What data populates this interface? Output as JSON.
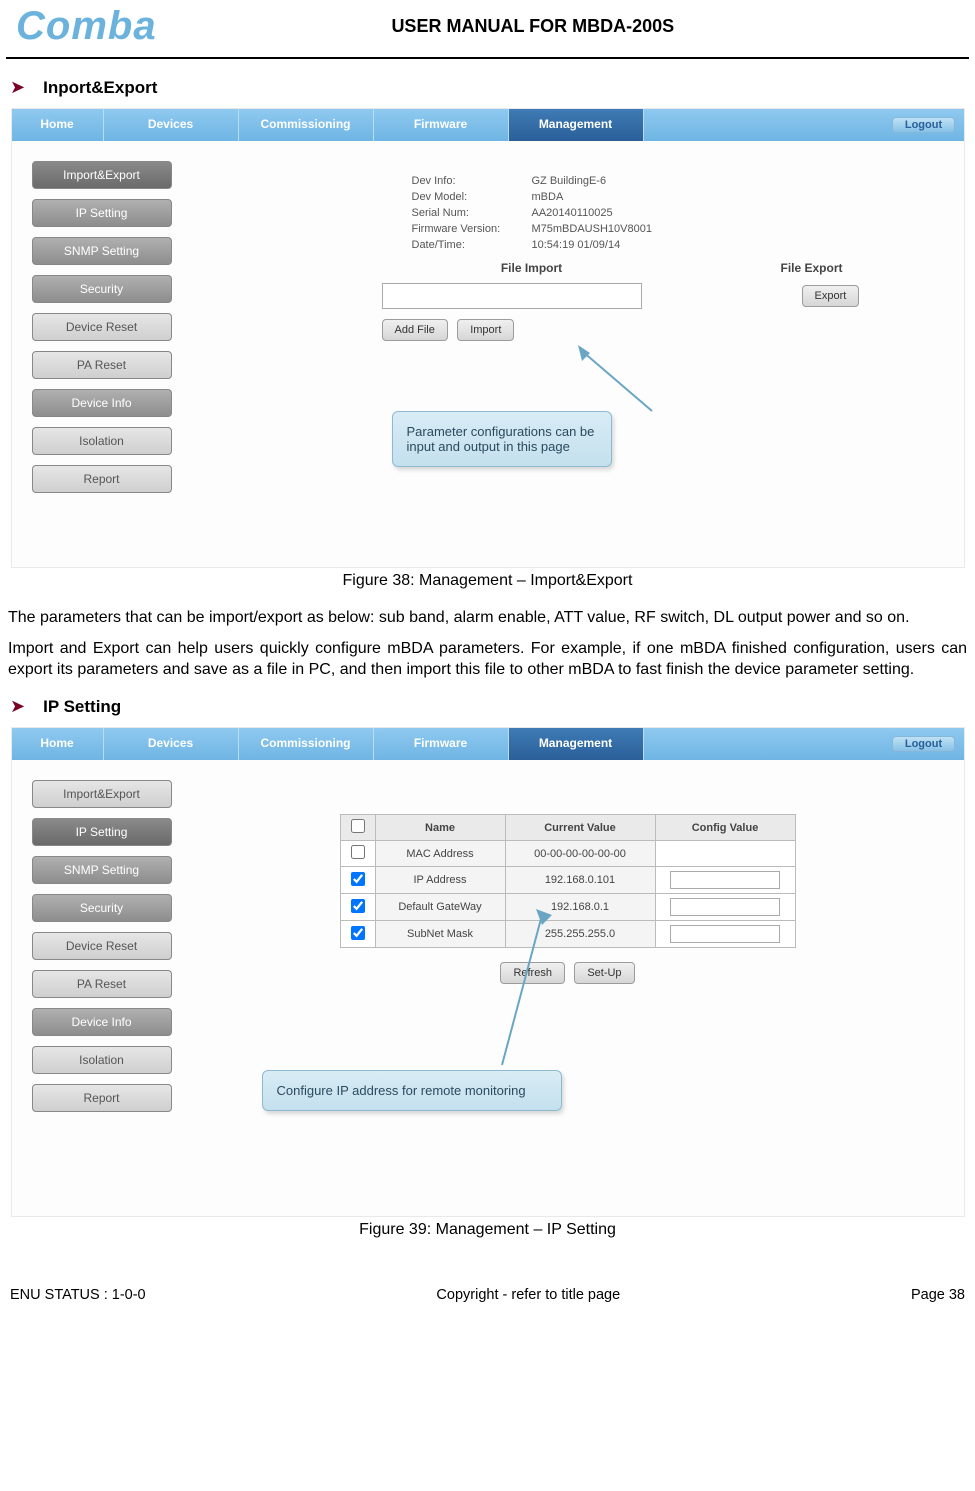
{
  "header": {
    "logo": "Comba",
    "doc_title": "USER MANUAL FOR MBDA-200S"
  },
  "sections": {
    "s1_title": "Inport&Export",
    "s2_title": "IP Setting"
  },
  "nav": {
    "home": "Home",
    "devices": "Devices",
    "commissioning": "Commissioning",
    "firmware": "Firmware",
    "management": "Management",
    "logout": "Logout"
  },
  "sidebar": {
    "items": [
      {
        "label": "Import&Export"
      },
      {
        "label": "IP Setting"
      },
      {
        "label": "SNMP Setting"
      },
      {
        "label": "Security"
      },
      {
        "label": "Device Reset"
      },
      {
        "label": "PA Reset"
      },
      {
        "label": "Device Info"
      },
      {
        "label": "Isolation"
      },
      {
        "label": "Report"
      }
    ]
  },
  "fig1": {
    "dev_info_lbl": "Dev Info:",
    "dev_info_val": "GZ BuildingE-6",
    "dev_model_lbl": "Dev Model:",
    "dev_model_val": "mBDA",
    "serial_lbl": "Serial Num:",
    "serial_val": "AA20140110025",
    "fw_lbl": "Firmware Version:",
    "fw_val": "M75mBDAUSH10V8001",
    "dt_lbl": "Date/Time:",
    "dt_val": "10:54:19 01/09/14",
    "file_import": "File Import",
    "file_export": "File Export",
    "export_btn": "Export",
    "addfile_btn": "Add File",
    "import_btn": "Import",
    "callout": "Parameter configurations can be input and output in this page"
  },
  "caption1": "Figure 38: Management – Import&Export",
  "para1": "The parameters that can be import/export as below: sub band, alarm enable, ATT value, RF switch, DL output power and so on.",
  "para2": "Import and Export can help users quickly configure mBDA parameters. For example, if one mBDA finished configuration, users can export its parameters and save as a file in PC, and then import this file to other mBDA to fast finish the device parameter setting.",
  "fig2": {
    "th_name": "Name",
    "th_cur": "Current Value",
    "th_cfg": "Config Value",
    "rows": [
      {
        "check": false,
        "name": "MAC Address",
        "cur": "00-00-00-00-00-00",
        "editable": false
      },
      {
        "check": true,
        "name": "IP Address",
        "cur": "192.168.0.101",
        "editable": true
      },
      {
        "check": true,
        "name": "Default GateWay",
        "cur": "192.168.0.1",
        "editable": true
      },
      {
        "check": true,
        "name": "SubNet Mask",
        "cur": "255.255.255.0",
        "editable": true
      }
    ],
    "refresh_btn": "Refresh",
    "setup_btn": "Set-Up",
    "callout": "Configure IP address for remote monitoring"
  },
  "caption2": "Figure 39: Management – IP Setting",
  "footer": {
    "left": "ENU STATUS : 1-0-0",
    "center": "Copyright - refer to title page",
    "right": "Page 38"
  }
}
